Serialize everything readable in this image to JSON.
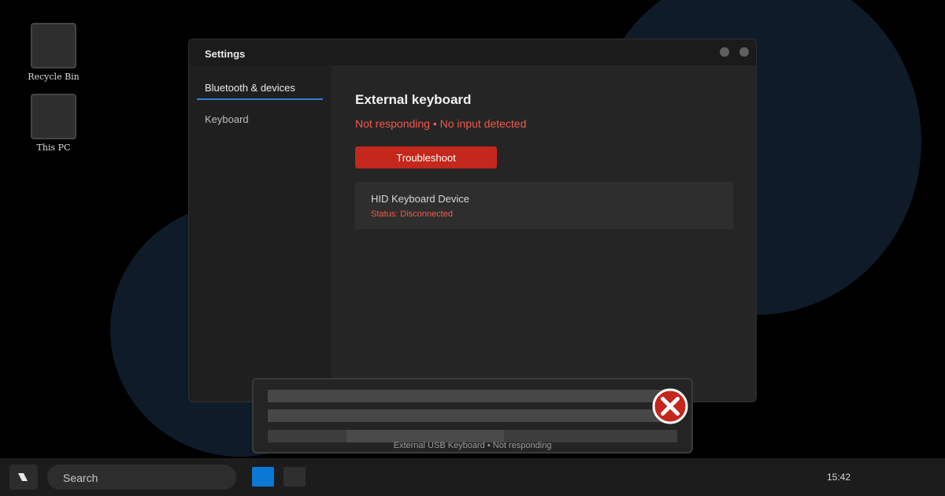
{
  "desktop": {
    "icons": [
      {
        "label": "Recycle Bin"
      },
      {
        "label": "This PC"
      }
    ]
  },
  "window": {
    "title": "Settings",
    "sidebar": {
      "items": [
        {
          "label": "Bluetooth & devices",
          "selected": true
        },
        {
          "label": "Keyboard",
          "selected": false
        }
      ]
    },
    "main": {
      "heading": "External keyboard",
      "status": "Not responding • No input detected",
      "troubleshoot_label": "Troubleshoot",
      "device": {
        "name": "HID Keyboard Device",
        "status": "Status: Disconnected"
      }
    }
  },
  "notification": {
    "text": "External USB Keyboard • Not responding",
    "icon": "error-icon"
  },
  "taskbar": {
    "search_label": "Search",
    "time": "15:42"
  },
  "colors": {
    "accent": "#2f81d6",
    "error": "#c4271c",
    "error_text": "#f15a4e",
    "taskbar_app": "#0a78d4"
  }
}
